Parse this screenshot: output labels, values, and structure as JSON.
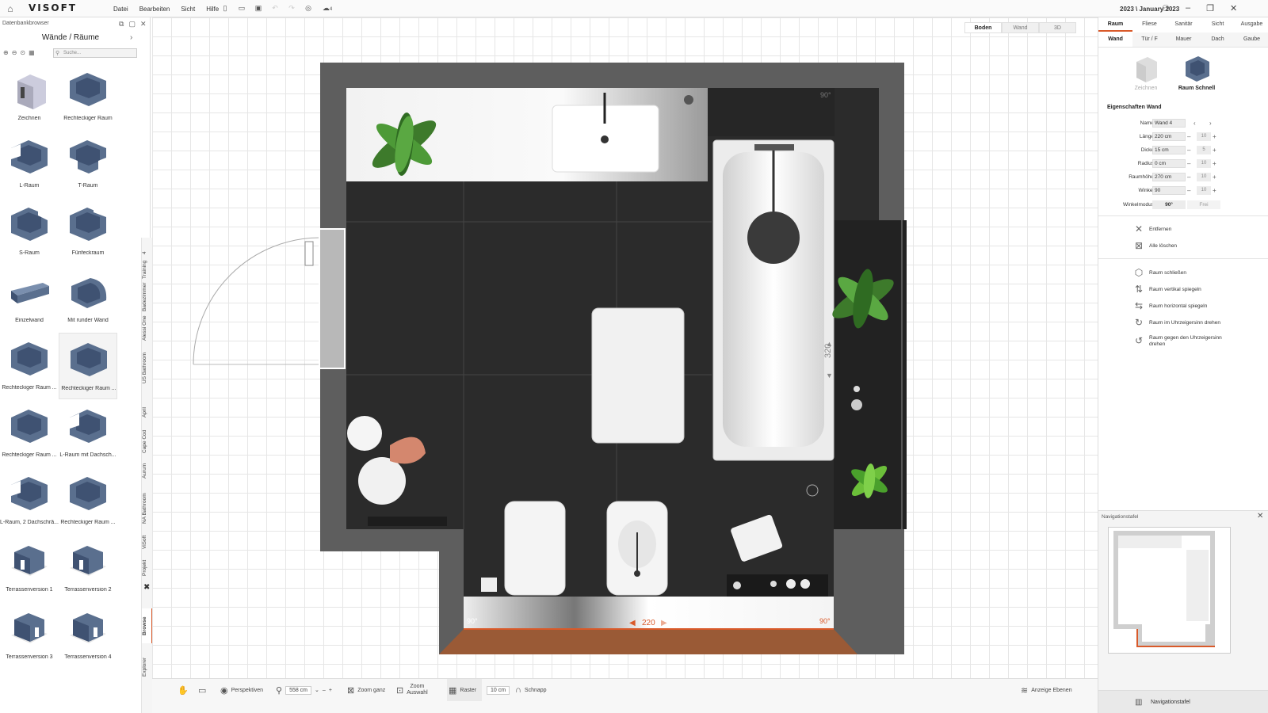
{
  "titlebar": {
    "logo": "VISOFT",
    "menu": [
      "Datei",
      "Bearbeiten",
      "Sicht",
      "Hilfe"
    ],
    "badge": "4",
    "date": "2023 \\ January 2023"
  },
  "left_panel": {
    "header": "Datenbankbrowser",
    "title": "Wände / Räume",
    "search_placeholder": "Suche...",
    "items": [
      "Zeichnen",
      "Rechteckiger Raum",
      "L-Raum",
      "T-Raum",
      "S-Raum",
      "Fünfeckraum",
      "Einzelwand",
      "Mit runder Wand",
      "Rechteckiger Raum ...",
      "Rechteckiger Raum ...",
      "Rechteckiger Raum ...",
      "L-Raum mit Dachsch...",
      "L-Raum, 2 Dachschrä...",
      "Rechteckiger Raum ...",
      "Terrassenversion 1",
      "Terrassenversion 2",
      "Terrassenversion 3",
      "Terrassenversion 4"
    ],
    "vertical_tabs": [
      "4",
      "Training",
      "Badezimmer",
      "Alessi One",
      "US Bathroom",
      "April",
      "Cape Cod",
      "Aurum",
      "NA Bathroom",
      "ViSoft",
      "Projekt",
      "Browse",
      "Explorer"
    ]
  },
  "view_tabs": [
    "Boden",
    "Wand",
    "3D"
  ],
  "floorplan": {
    "corner_angles": [
      "90°",
      "90°",
      "90°"
    ],
    "dim_bottom": "220",
    "dim_right": "320"
  },
  "bottom_bar": {
    "perspectives": "Perspektiven",
    "zoom_value": "558 cm",
    "zoom_all": "Zoom ganz",
    "zoom_selection_1": "Zoom",
    "zoom_selection_2": "Auswahl",
    "grid": "Raster",
    "grid_value": "10 cm",
    "snap": "Schnapp",
    "layers": "Anzeige Ebenen"
  },
  "right_panel": {
    "tabs_top": [
      "Raum",
      "Fliese",
      "Sanitär",
      "Sicht",
      "Ausgabe"
    ],
    "tabs_sub": [
      "Wand",
      "Tür / F",
      "Mauer",
      "Dach",
      "Gaube"
    ],
    "modes": [
      "Zeichnen",
      "Raum Schnell"
    ],
    "props_title": "Eigenschaften Wand",
    "props": [
      {
        "label": "Name",
        "value": "Wand 4",
        "step": ""
      },
      {
        "label": "Länge",
        "value": "220 cm",
        "step": "10"
      },
      {
        "label": "Dicke",
        "value": "15 cm",
        "step": "5"
      },
      {
        "label": "Radius",
        "value": "0 cm",
        "step": "10"
      },
      {
        "label": "Raumhöhe",
        "value": "270 cm",
        "step": "10"
      },
      {
        "label": "Winkel",
        "value": "90",
        "step": "10"
      }
    ],
    "angle_mode_label": "Winkelmodus",
    "angle_mode_options": [
      "90°",
      "Frei"
    ],
    "actions_a": [
      "Entfernen",
      "Alle löschen"
    ],
    "actions_b": [
      "Raum schließen",
      "Raum vertikal spiegeln",
      "Raum horizontal spiegeln",
      "Raum im Uhrzeigersinn drehen",
      "Raum gegen den Uhrzeigersinn drehen"
    ],
    "nav_title": "Navigationstafel",
    "nav_footer": "Navigationstafel"
  },
  "colors": {
    "accent": "#d95a2a",
    "wall": "#5e5e5e",
    "floor": "#2a2a2a",
    "wood": "#9a5a36",
    "room_icon": "#5a6f8e"
  }
}
